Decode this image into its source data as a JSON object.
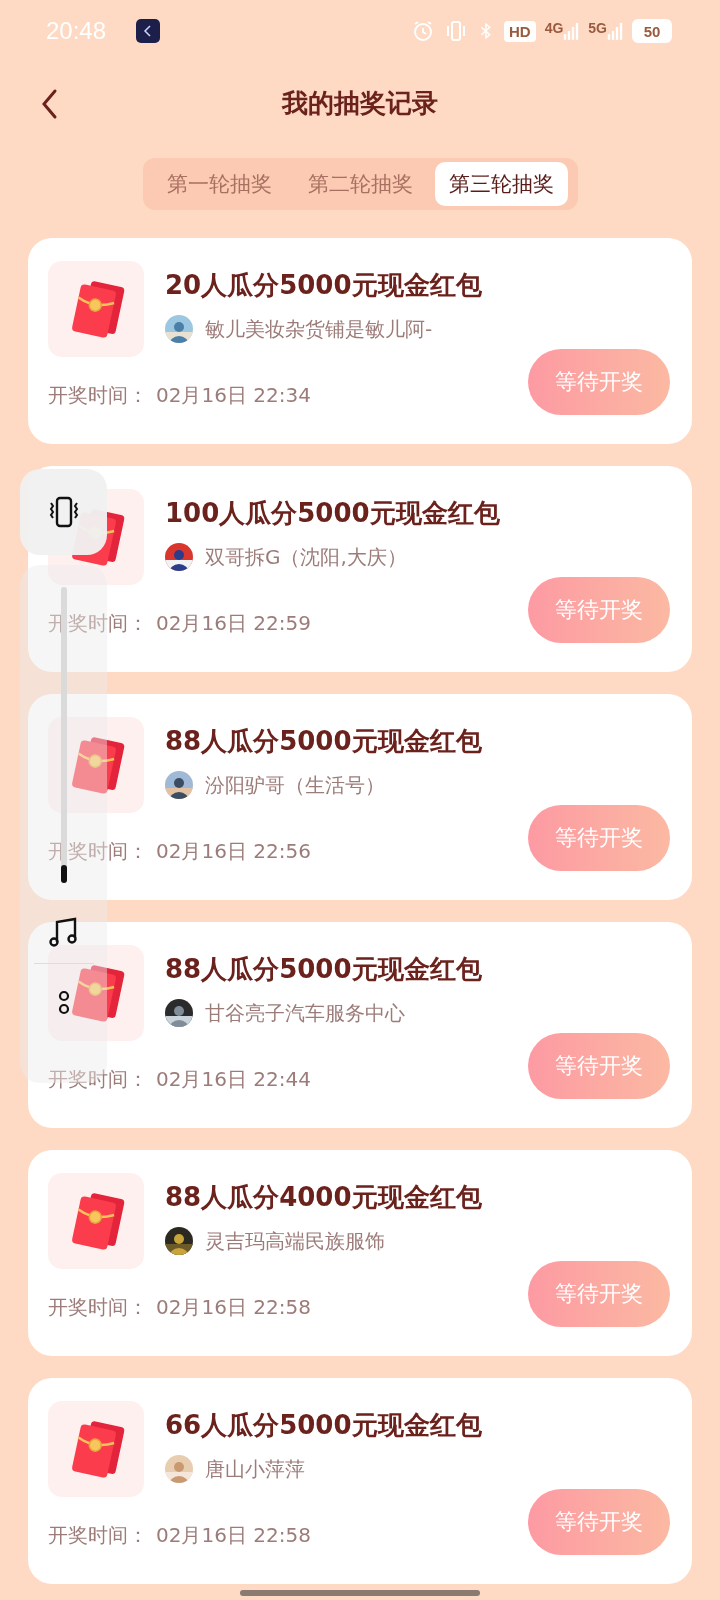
{
  "status_bar": {
    "time": "20:48",
    "hd": "HD",
    "networks": [
      "4G",
      "5G"
    ],
    "battery": "50"
  },
  "header": {
    "title": "我的抽奖记录"
  },
  "tabs": [
    {
      "label": "第一轮抽奖",
      "selected": false
    },
    {
      "label": "第二轮抽奖",
      "selected": false
    },
    {
      "label": "第三轮抽奖",
      "selected": true
    }
  ],
  "records": [
    {
      "title": "20人瓜分5000元现金红包",
      "host": "敏儿美妆杂货铺是敏儿阿-",
      "time_label": "开奖时间：",
      "time": "02月16日 22:34",
      "button": "等待开奖"
    },
    {
      "title": "100人瓜分5000元现金红包",
      "host": "双哥拆G（沈阳,大庆）",
      "time_label": "开奖时间：",
      "time": "02月16日 22:59",
      "button": "等待开奖"
    },
    {
      "title": "88人瓜分5000元现金红包",
      "host": "汾阳驴哥（生活号）",
      "time_label": "开奖时间：",
      "time": "02月16日 22:56",
      "button": "等待开奖"
    },
    {
      "title": "88人瓜分5000元现金红包",
      "host": "甘谷亮子汽车服务中心",
      "time_label": "开奖时间：",
      "time": "02月16日 22:44",
      "button": "等待开奖"
    },
    {
      "title": "88人瓜分4000元现金红包",
      "host": "灵吉玛高端民族服饰",
      "time_label": "开奖时间：",
      "time": "02月16日 22:58",
      "button": "等待开奖"
    },
    {
      "title": "66人瓜分5000元现金红包",
      "host": "唐山小萍萍",
      "time_label": "开奖时间：",
      "time": "02月16日 22:58",
      "button": "等待开奖"
    }
  ],
  "volume_panel": {
    "level": 0.06
  }
}
